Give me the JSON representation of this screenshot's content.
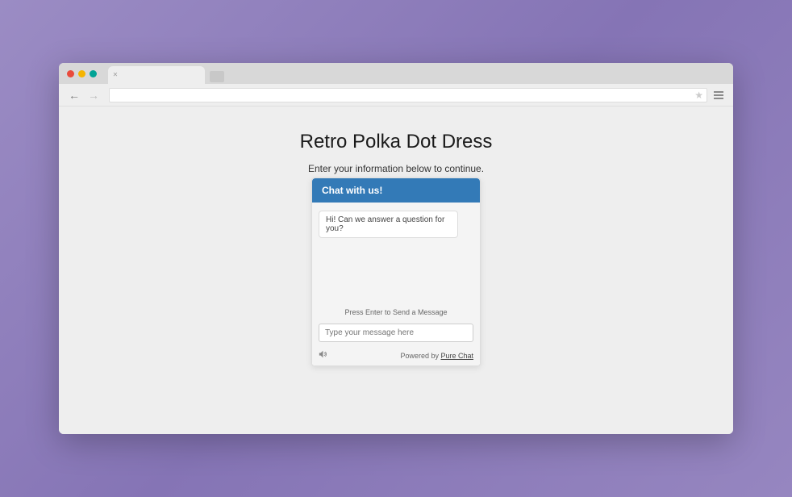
{
  "page": {
    "title": "Retro Polka Dot Dress",
    "subtitle": "Enter your information below to continue."
  },
  "chat": {
    "header": "Chat with us!",
    "message": "Hi! Can we answer a question for you?",
    "hint": "Press Enter to Send a Message",
    "placeholder": "Type your message here",
    "powered_prefix": "Powered by ",
    "powered_link": "Pure Chat"
  }
}
